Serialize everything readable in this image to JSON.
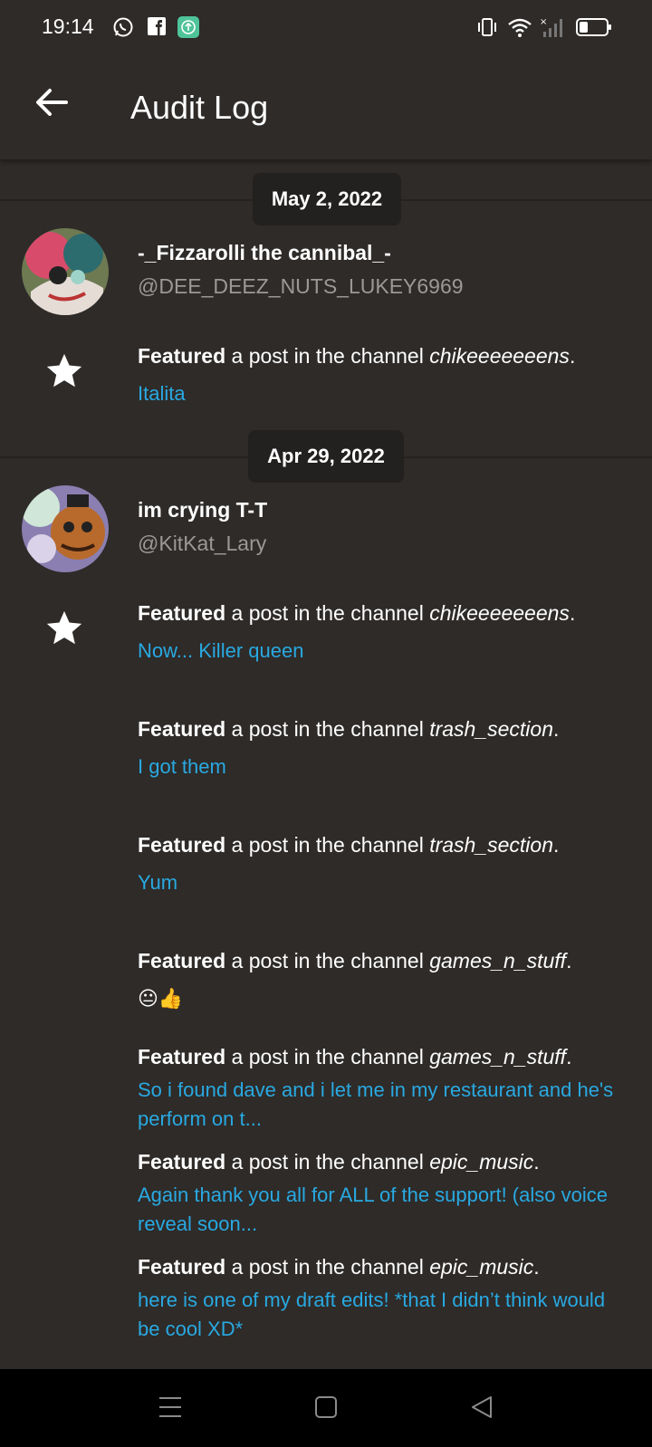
{
  "status_bar": {
    "time": "19:14",
    "left_icons": [
      "whatsapp-icon",
      "facebook-icon",
      "app-update-icon"
    ],
    "right_icons": [
      "vibrate-icon",
      "wifi-icon",
      "signal-icon",
      "battery-icon"
    ]
  },
  "app_bar": {
    "back_icon": "arrow-left-icon",
    "title": "Audit Log"
  },
  "groups": [
    {
      "date": "May 2, 2022",
      "user": {
        "name": "-_Fizzarolli the cannibal_-",
        "handle": "@DEE_DEEZ_NUTS_LUKEY6969"
      },
      "entries": [
        {
          "action": "Featured",
          "middle": " a post in the channel ",
          "channel": "chikeeeeeeens",
          "end": ".",
          "preview": "Italita"
        }
      ]
    },
    {
      "date": "Apr 29, 2022",
      "user": {
        "name": "im crying T-T",
        "handle": "@KitKat_Lary"
      },
      "entries": [
        {
          "action": "Featured",
          "middle": " a post in the channel ",
          "channel": "chikeeeeeeens",
          "end": ".",
          "preview": "Now... Killer queen"
        },
        {
          "action": "Featured",
          "middle": " a post in the channel ",
          "channel": "trash_section",
          "end": ".",
          "preview": "I got them"
        },
        {
          "action": "Featured",
          "middle": " a post in the channel ",
          "channel": "trash_section",
          "end": ".",
          "preview": "Yum"
        },
        {
          "action": "Featured",
          "middle": " a post in the channel ",
          "channel": "games_n_stuff",
          "end": ".",
          "preview": "😐👍"
        },
        {
          "action": "Featured",
          "middle": " a post in the channel ",
          "channel": "games_n_stuff",
          "end": ".",
          "preview": "So i found dave and i let me in my restaurant and he's perform on t..."
        },
        {
          "action": "Featured",
          "middle": " a post in the channel ",
          "channel": "epic_music",
          "end": ".",
          "preview": "Again thank you all for ALL of the support! (also voice reveal soon..."
        },
        {
          "action": "Featured",
          "middle": " a post in the channel ",
          "channel": "epic_music",
          "end": ".",
          "preview": "here is one of my draft edits! *that I didn’t think would be cool XD*"
        }
      ]
    }
  ],
  "nav_bar": {
    "icons": [
      "menu-icon",
      "home-square-icon",
      "back-triangle-icon"
    ]
  },
  "colors": {
    "background": "#2e2b29",
    "link": "#29a9e1",
    "handle": "#9b9896",
    "pill": "#232120"
  }
}
